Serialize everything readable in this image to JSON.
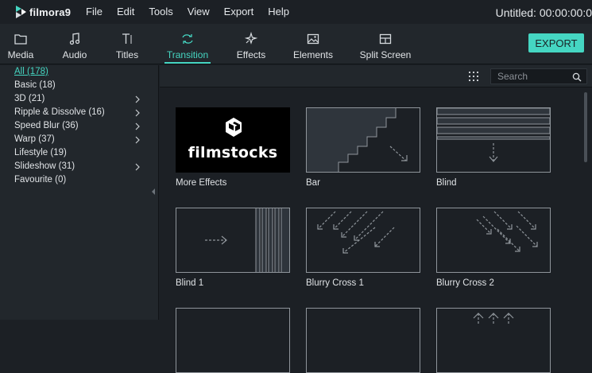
{
  "app": {
    "logo_text": "filmora9",
    "window_title": "Untitled:  00:00:00:0"
  },
  "menu": [
    "File",
    "Edit",
    "Tools",
    "View",
    "Export",
    "Help"
  ],
  "tabs": [
    {
      "label": "Media",
      "icon": "folder-icon"
    },
    {
      "label": "Audio",
      "icon": "music-note-icon"
    },
    {
      "label": "Titles",
      "icon": "text-icon"
    },
    {
      "label": "Transition",
      "icon": "transition-icon",
      "active": true
    },
    {
      "label": "Effects",
      "icon": "sparkle-icon"
    },
    {
      "label": "Elements",
      "icon": "image-icon"
    },
    {
      "label": "Split Screen",
      "icon": "split-screen-icon"
    }
  ],
  "export_label": "EXPORT",
  "categories": [
    {
      "label": "All (178)",
      "active": true,
      "has_children": false
    },
    {
      "label": "Basic (18)",
      "has_children": false
    },
    {
      "label": "3D (21)",
      "has_children": true
    },
    {
      "label": "Ripple & Dissolve (16)",
      "has_children": true
    },
    {
      "label": "Speed Blur (36)",
      "has_children": true
    },
    {
      "label": "Warp (37)",
      "has_children": true
    },
    {
      "label": "Lifestyle (19)",
      "has_children": false
    },
    {
      "label": "Slideshow (31)",
      "has_children": true
    },
    {
      "label": "Favourite (0)",
      "has_children": false
    }
  ],
  "search": {
    "placeholder": "Search",
    "value": ""
  },
  "items": [
    {
      "name": "More Effects",
      "thumb_text": "filmstocks"
    },
    {
      "name": "Bar"
    },
    {
      "name": "Blind"
    },
    {
      "name": "Blind 1"
    },
    {
      "name": "Blurry Cross 1"
    },
    {
      "name": "Blurry Cross 2"
    }
  ],
  "colors": {
    "accent": "#45d6c2",
    "background": "#1c2025",
    "panel": "#22272c"
  }
}
